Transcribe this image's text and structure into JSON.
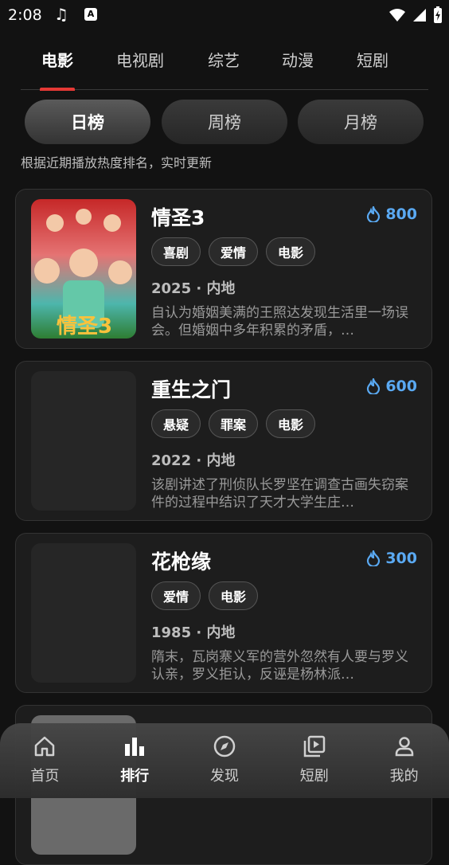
{
  "status": {
    "time": "2:08"
  },
  "categories": [
    "电影",
    "电视剧",
    "综艺",
    "动漫",
    "短剧"
  ],
  "periods": [
    "日榜",
    "周榜",
    "月榜"
  ],
  "hint": "根据近期播放热度排名，实时更新",
  "items": [
    {
      "title": "情圣3",
      "heat": "800",
      "tags": [
        "喜剧",
        "爱情",
        "电影"
      ],
      "meta": "2025 · 内地",
      "desc": "自认为婚姻美满的王照达发现生活里一场误会。但婚姻中多年积累的矛盾，…",
      "poster_text": "情圣3"
    },
    {
      "title": "重生之门",
      "heat": "600",
      "tags": [
        "悬疑",
        "罪案",
        "电影"
      ],
      "meta": "2022 · 内地",
      "desc": "该剧讲述了刑侦队长罗坚在调查古画失窃案件的过程中结识了天才大学生庄…"
    },
    {
      "title": "花枪缘",
      "heat": "300",
      "tags": [
        "爱情",
        "电影"
      ],
      "meta": "1985 · 内地",
      "desc": "隋末，瓦岗寨义军的营外忽然有人要与罗义认亲，罗义拒认，反诬是杨林派…"
    }
  ],
  "nav": [
    "首页",
    "排行",
    "发现",
    "短剧",
    "我的"
  ],
  "colors": {
    "accent_red": "#e53935",
    "heat_blue": "#5aa9f2"
  }
}
